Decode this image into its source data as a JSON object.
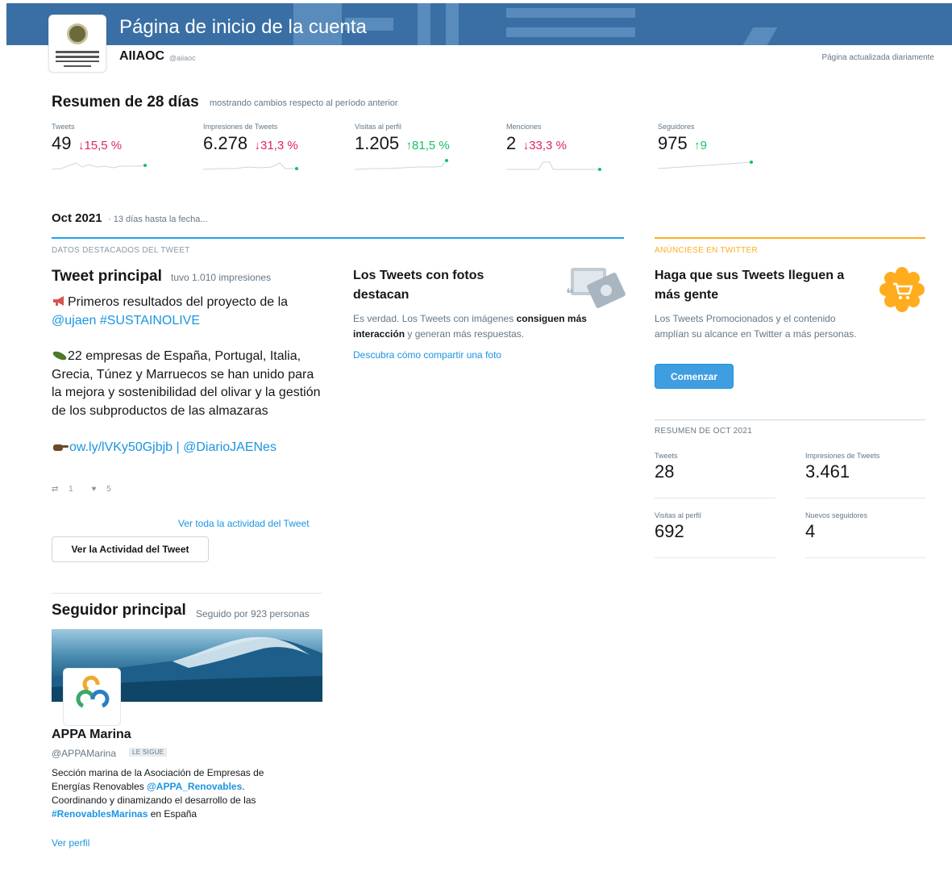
{
  "header": {
    "page_title": "Página de inicio de la cuenta",
    "account_name": "AIIAOC",
    "account_handle": "@aiiaoc",
    "updated_note": "Página actualizada diariamente"
  },
  "summary": {
    "title": "Resumen de 28 días",
    "subtitle": "mostrando cambios respecto al período anterior",
    "metrics": [
      {
        "label": "Tweets",
        "value": "49",
        "change": "15,5 %",
        "direction": "down",
        "arrow": "↓"
      },
      {
        "label": "Impresiones de Tweets",
        "value": "6.278",
        "change": "31,3 %",
        "direction": "down",
        "arrow": "↓"
      },
      {
        "label": "Visitas al perfil",
        "value": "1.205",
        "change": "81,5 %",
        "direction": "up",
        "arrow": "↑"
      },
      {
        "label": "Menciones",
        "value": "2",
        "change": "33,3 %",
        "direction": "down",
        "arrow": "↓"
      },
      {
        "label": "Seguidores",
        "value": "975",
        "change": "9",
        "direction": "up",
        "arrow": "↑"
      }
    ]
  },
  "period": {
    "title": "Oct 2021",
    "subtitle": "· 13 días hasta la fecha..."
  },
  "highlights": {
    "header": "DATOS DESTACADOS DEL TWEET",
    "top_tweet": {
      "title": "Tweet principal",
      "subtitle": "tuvo 1.010 impresiones",
      "line1_text": "Primeros resultados del proyecto de la ",
      "line1_link": "@ujaen #SUSTAINOLIVE",
      "paragraph2": "22 empresas de España, Portugal, Italia, Grecia, Túnez y Marruecos se han unido para la mejora y sostenibilidad del olivar y la gestión de los subproductos de las almazaras",
      "link_url": "ow.ly/lVKy50Gjbjb",
      "link_separator": " | ",
      "link_mention": "@DiarioJAENes",
      "retweets": "1",
      "likes": "5",
      "all_activity_link": "Ver toda la actividad del Tweet",
      "activity_button": "Ver la Actividad del Tweet"
    },
    "photo_tip": {
      "title": "Los Tweets con fotos destacan",
      "body_start": "Es verdad. Los Tweets con imágenes ",
      "body_bold": "consiguen más interacción",
      "body_end": " y generan más respuestas.",
      "link": "Descubra cómo compartir una foto"
    },
    "top_follower": {
      "title": "Seguidor principal",
      "subtitle": "Seguido por 923 personas",
      "name": "APPA Marina",
      "handle": "@APPAMarina",
      "badge": "LE SIGUE",
      "bio_1": "Sección marina de la Asociación de Empresas de Energías Renovables ",
      "bio_mention": "@APPA_Renovables",
      "bio_2": ". Coordinando y dinamizando el desarrollo de las ",
      "bio_hashtag": "#RenovablesMarinas",
      "bio_3": " en España",
      "view_profile": "Ver perfil"
    }
  },
  "ad": {
    "header": "ANÚNCIESE EN TWITTER",
    "title": "Haga que sus Tweets lleguen a más gente",
    "body": "Los Tweets Promocionados y el contenido amplían su alcance en Twitter a más personas.",
    "button": "Comenzar"
  },
  "oct_summary": {
    "header": "RESUMEN DE OCT 2021",
    "tweets_label": "Tweets",
    "tweets_value": "28",
    "impressions_label": "Impresiones de Tweets",
    "impressions_value": "3.461",
    "visits_label": "Visitas al perfil",
    "visits_value": "692",
    "followers_label": "Nuevos seguidores",
    "followers_value": "4"
  },
  "colors": {
    "accent_blue": "#1da1f2",
    "link_blue": "#1b95e0",
    "down_red": "#e0245e",
    "up_green": "#17bf63",
    "ad_orange": "#ffad1f",
    "banner_blue": "#3a6fa5"
  }
}
